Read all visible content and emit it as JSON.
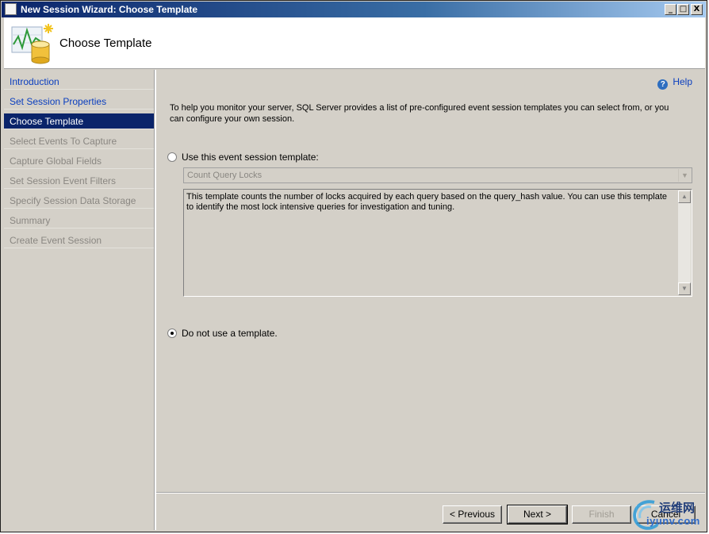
{
  "window": {
    "title": "New Session Wizard: Choose Template",
    "controls": {
      "minimize": "_",
      "maximize": "□",
      "close": "X"
    }
  },
  "header": {
    "title": "Choose Template",
    "icon": "chart-database-icon"
  },
  "nav": {
    "items": [
      {
        "label": "Introduction",
        "state": "link"
      },
      {
        "label": "Set Session Properties",
        "state": "link"
      },
      {
        "label": "Choose Template",
        "state": "selected"
      },
      {
        "label": "Select Events To Capture",
        "state": "disabled"
      },
      {
        "label": "Capture Global Fields",
        "state": "disabled"
      },
      {
        "label": "Set Session Event Filters",
        "state": "disabled"
      },
      {
        "label": "Specify Session Data Storage",
        "state": "disabled"
      },
      {
        "label": "Summary",
        "state": "disabled"
      },
      {
        "label": "Create Event Session",
        "state": "disabled"
      }
    ]
  },
  "main": {
    "help_label": "Help",
    "intro": "To help you monitor your server, SQL Server provides a list of pre-configured event session templates you can select from, or you can configure your own session.",
    "use_template": {
      "label": "Use this event session template:",
      "checked": false,
      "selected_template": "Count Query Locks",
      "description": "This template counts the number of locks acquired by each query based on the query_hash value. You can use this template to identify the most lock intensive queries for investigation and tuning."
    },
    "no_template": {
      "label": "Do not use a template.",
      "checked": true
    }
  },
  "footer": {
    "previous": "< Previous",
    "next": "Next >",
    "finish": "Finish",
    "cancel": "Cancel"
  },
  "watermark": {
    "cn": "运维网",
    "url": "iyunv.com"
  },
  "colors": {
    "selected_nav": "#0a246a",
    "link": "#0a3ebf",
    "disabled_text": "#8a8782",
    "dialog_bg": "#d4d0c8"
  }
}
